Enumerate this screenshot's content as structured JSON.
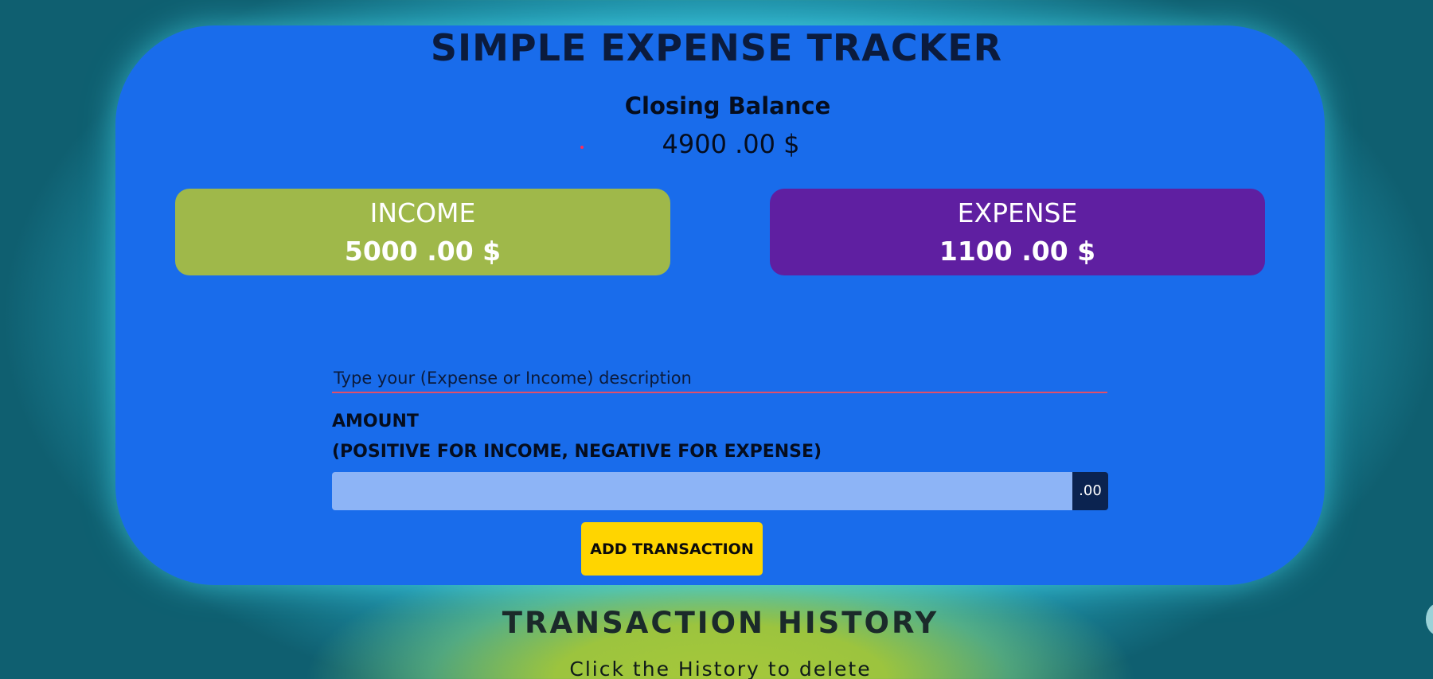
{
  "app": {
    "title": "SIMPLE EXPENSE TRACKER"
  },
  "balance": {
    "label": "Closing Balance",
    "value": "4900 .00 $"
  },
  "income": {
    "label": "INCOME",
    "value": "5000 .00 $"
  },
  "expense": {
    "label": "EXPENSE",
    "value": "1100 .00 $"
  },
  "form": {
    "description_placeholder": "Type your (Expense or Income) description",
    "description_value": "",
    "amount_label_line1": "AMOUNT",
    "amount_label_line2": "(POSITIVE FOR INCOME, NEGATIVE FOR EXPENSE)",
    "amount_value": "",
    "decimal_suffix": ".00",
    "submit_label": "ADD TRANSACTION"
  },
  "history": {
    "title": "TRANSACTION HISTORY",
    "hint": "Click the History to delete"
  },
  "colors": {
    "card": "#196ceb",
    "income_box": "#9fb84a",
    "expense_box": "#5f1fa1",
    "submit_button": "#ffd500",
    "amount_input": "#8db4f6",
    "decimal_addon": "#0b2350",
    "description_underline": "#e0506a"
  }
}
